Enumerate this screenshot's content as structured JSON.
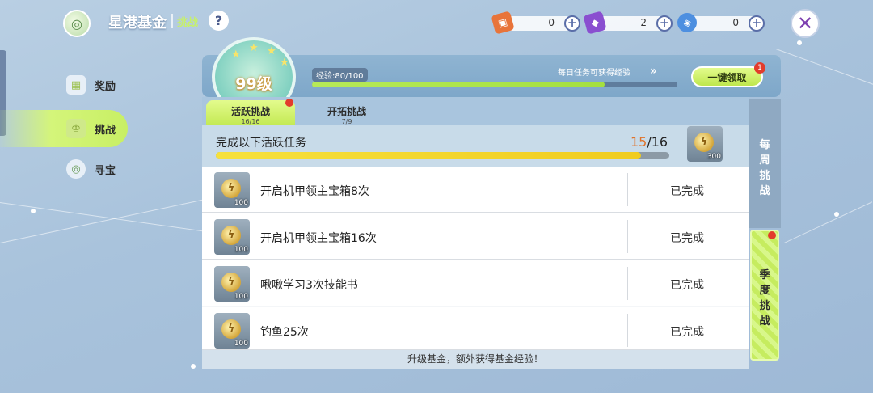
{
  "header": {
    "title": "星港基金",
    "subtitle": "挑战",
    "help_label": "?",
    "close_label": "✕",
    "resources": [
      {
        "icon": "ticket-icon",
        "value": "0",
        "color": "#e8743a"
      },
      {
        "icon": "purple-card-icon",
        "value": "2",
        "color": "#8a4fd0"
      },
      {
        "icon": "blue-crystal-icon",
        "value": "0",
        "color": "#4d8fe0"
      }
    ]
  },
  "sidebar": {
    "items": [
      {
        "label": "奖励",
        "icon": "gift-icon",
        "active": false
      },
      {
        "label": "挑战",
        "icon": "trophy-icon",
        "active": true
      },
      {
        "label": "寻宝",
        "icon": "treasure-icon",
        "active": false
      }
    ]
  },
  "level": {
    "level_text": "99级",
    "exp_text": "经验:80/100",
    "exp_progress": 0.8,
    "daily_text": "每日任务可获得经验",
    "claim_label": "一键领取",
    "claim_badge": "1"
  },
  "tabs": [
    {
      "label": "活跃挑战",
      "sub": "16/16",
      "active": true,
      "dot": true
    },
    {
      "label": "开拓挑战",
      "sub": "7/9",
      "active": false,
      "dot": false
    }
  ],
  "summary": {
    "title": "完成以下活跃任务",
    "current": "15",
    "total": "/16",
    "progress": 0.9375,
    "reward_amount": "300"
  },
  "tasks": [
    {
      "name": "开启机甲领主宝箱8次",
      "reward": "100",
      "status": "已完成"
    },
    {
      "name": "开启机甲领主宝箱16次",
      "reward": "100",
      "status": "已完成"
    },
    {
      "name": "啾啾学习3次技能书",
      "reward": "100",
      "status": "已完成"
    },
    {
      "name": "钓鱼25次",
      "reward": "100",
      "status": "已完成"
    }
  ],
  "footer_note": "升级基金，额外获得基金经验！",
  "side_tabs": {
    "weekly": "每周挑战",
    "season": "季度挑战"
  }
}
